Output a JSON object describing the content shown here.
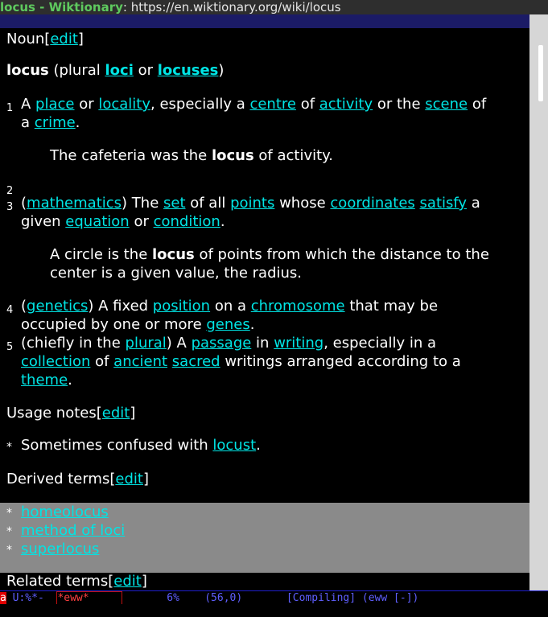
{
  "window": {
    "title_prefix": "locus - Wiktionary",
    "title_sep": ":",
    "url": "https://en.wiktionary.org/wiki/locus"
  },
  "content": {
    "noun_heading": "Noun",
    "edit": "edit",
    "headword": "locus",
    "plural_prefix": "(plural ",
    "plural_1": "loci",
    "plural_or": " or ",
    "plural_2": "locuses",
    "plural_close": ")",
    "def1": {
      "num": "1",
      "t1": "A ",
      "place": "place",
      "t2": " or ",
      "locality": "locality",
      "t3": ", especially a ",
      "centre": "centre",
      "t4": " of ",
      "activity": "activity",
      "t5": " or the ",
      "scene": "scene",
      "t6": " of",
      "t7": "a ",
      "crime": "crime",
      "t8": "."
    },
    "ex1": {
      "a": "The cafeteria was the ",
      "b": "locus",
      "c": " of activity."
    },
    "def2_num": "2",
    "def3": {
      "num": "3",
      "open": "(",
      "mathematics": "mathematics",
      "t1": ") The ",
      "set": "set",
      "t2": " of all ",
      "points": "points",
      "t3": " whose ",
      "coordinates": "coordinates",
      "sp": " ",
      "satisfy": "satisfy",
      "t4": " a",
      "t5": "given ",
      "equation": "equation",
      "t6": " or ",
      "condition": "condition",
      "t7": "."
    },
    "ex3": {
      "a": "A circle is the ",
      "b": "locus",
      "c": " of points from which the distance to the",
      "d": "center is a given value, the radius."
    },
    "def4": {
      "num": "4",
      "open": "(",
      "genetics": "genetics",
      "t1": ") A fixed ",
      "position": "position",
      "t2": " on a ",
      "chromosome": "chromosome",
      "t3": " that may be",
      "t4": "occupied by one or more ",
      "genes": "genes",
      "t5": "."
    },
    "def5": {
      "num": "5",
      "t1": "(chiefly in the ",
      "plural": "plural",
      "t2": ") A ",
      "passage": "passage",
      "t3": " in ",
      "writing": "writing",
      "t4": ", especially in a",
      "collection": "collection",
      "t5": " of ",
      "ancient": "ancient",
      "sp": " ",
      "sacred": "sacred",
      "t6": " writings arranged according to a",
      "theme": "theme",
      "t7": "."
    },
    "usage_heading": "Usage notes",
    "usage_star": "*",
    "usage_text": "Sometimes confused with ",
    "locust": "locust",
    "usage_end": ".",
    "derived_heading": "Derived terms",
    "derived": [
      "homeolocus",
      "method of loci",
      "superlocus"
    ],
    "related_heading": "Related terms"
  },
  "modeline": {
    "flag": "a",
    "state": " U:%*-  ",
    "buffer": "*eww*",
    "percent": "6%",
    "position": "(56,0)",
    "mode": "[Compiling] (eww [-])"
  },
  "colors": {
    "link": "#00e5e5",
    "title_green": "#5ec95e",
    "modeline_blue": "#5f5fff"
  }
}
